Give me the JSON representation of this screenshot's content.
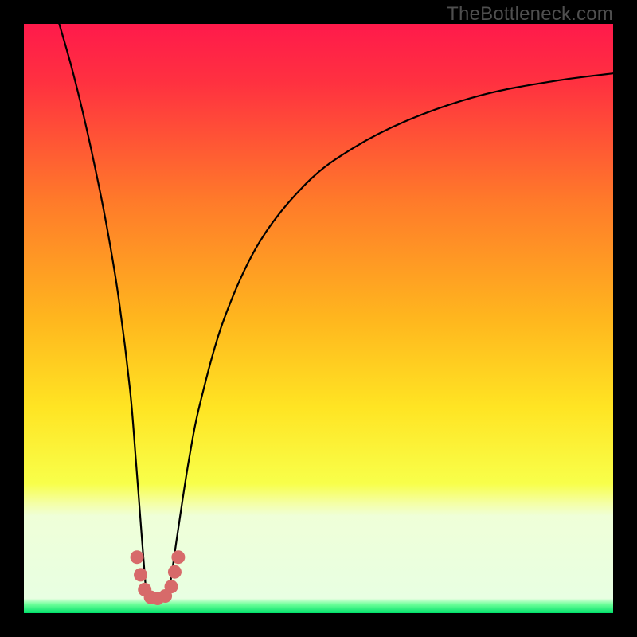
{
  "watermark": "TheBottleneck.com",
  "chart_data": {
    "type": "line",
    "title": "",
    "xlabel": "",
    "ylabel": "",
    "xlim": [
      0,
      100
    ],
    "ylim": [
      0,
      100
    ],
    "grid": false,
    "legend": false,
    "background_gradient": {
      "stops": [
        {
          "offset": 0.0,
          "color": "#ff1a4b"
        },
        {
          "offset": 0.1,
          "color": "#ff3140"
        },
        {
          "offset": 0.3,
          "color": "#ff7a2a"
        },
        {
          "offset": 0.5,
          "color": "#ffb61e"
        },
        {
          "offset": 0.65,
          "color": "#ffe423"
        },
        {
          "offset": 0.78,
          "color": "#f8ff4a"
        },
        {
          "offset": 0.815,
          "color": "#f4ffa9"
        },
        {
          "offset": 0.835,
          "color": "#efffd8"
        },
        {
          "offset": 0.975,
          "color": "#e8ffe2"
        },
        {
          "offset": 0.985,
          "color": "#6fff9a"
        },
        {
          "offset": 1.0,
          "color": "#00e06a"
        }
      ]
    },
    "series": [
      {
        "name": "left-branch",
        "x": [
          6,
          8,
          10,
          12,
          14,
          16,
          18,
          19,
          20,
          20.7
        ],
        "y": [
          100,
          93,
          85,
          76,
          66,
          54,
          38,
          26,
          13,
          4
        ]
      },
      {
        "name": "right-branch",
        "x": [
          24.7,
          26,
          28,
          30,
          34,
          40,
          48,
          56,
          66,
          78,
          90,
          100
        ],
        "y": [
          4,
          13,
          26,
          36,
          50,
          63,
          73,
          79,
          84,
          88,
          90.3,
          91.6
        ]
      },
      {
        "name": "valley-marker",
        "type": "marker-path",
        "color": "#d76a6a",
        "points_xy": [
          [
            19.2,
            9.5
          ],
          [
            19.8,
            6.5
          ],
          [
            20.5,
            4.0
          ],
          [
            21.5,
            2.7
          ],
          [
            22.7,
            2.5
          ],
          [
            24.0,
            2.9
          ],
          [
            25.0,
            4.5
          ],
          [
            25.6,
            7.0
          ],
          [
            26.2,
            9.5
          ]
        ]
      }
    ]
  }
}
